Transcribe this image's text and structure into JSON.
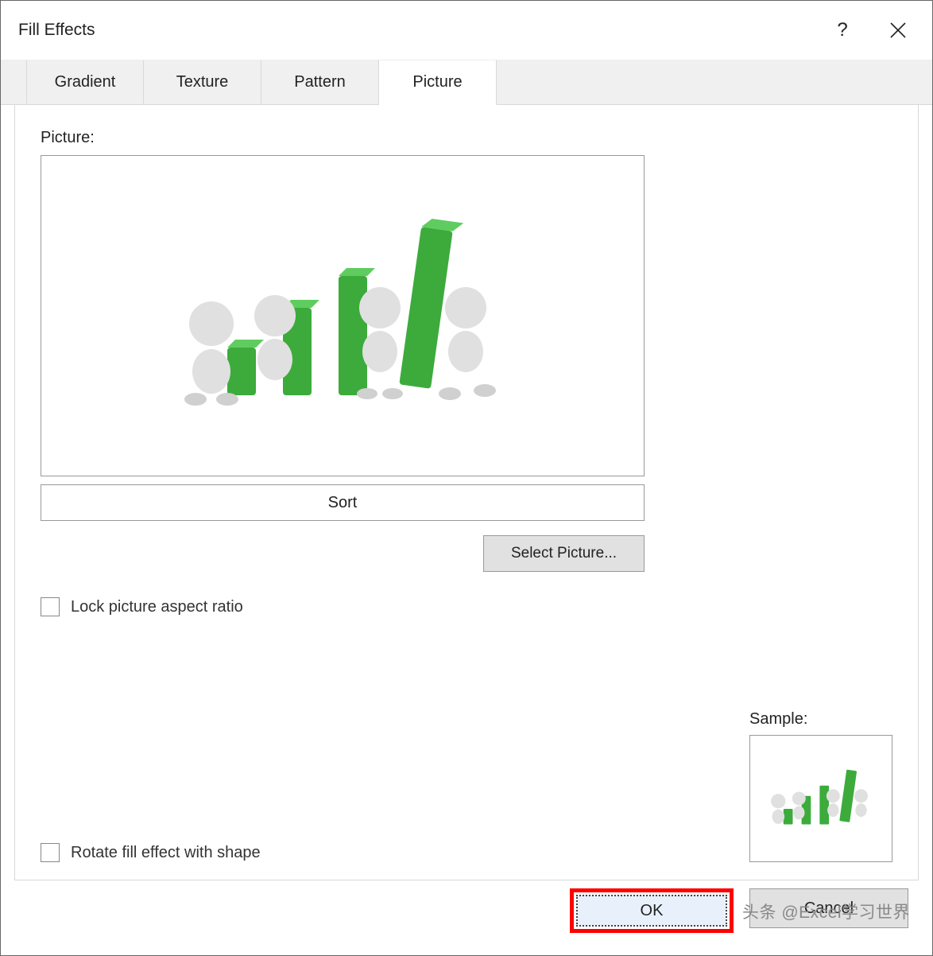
{
  "dialog": {
    "title": "Fill Effects"
  },
  "tabs": {
    "items": [
      "Gradient",
      "Texture",
      "Pattern",
      "Picture"
    ],
    "selected_index": 3
  },
  "picture_tab": {
    "picture_label": "Picture:",
    "sort_button": "Sort",
    "select_picture_button": "Select Picture...",
    "lock_aspect_label": "Lock picture aspect ratio",
    "lock_aspect_checked": false,
    "rotate_label": "Rotate fill effect with shape",
    "rotate_checked": false,
    "sample_label": "Sample:"
  },
  "buttons": {
    "ok": "OK",
    "cancel": "Cancel"
  },
  "watermark": "头条 @Excel学习世界"
}
